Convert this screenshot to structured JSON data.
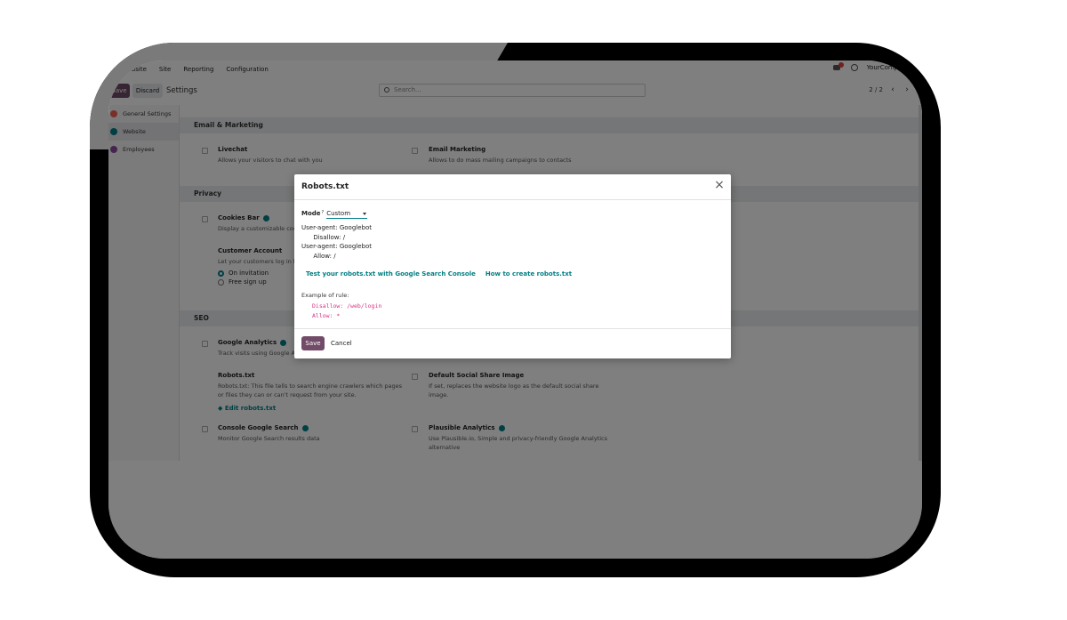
{
  "navbar": {
    "menu": [
      "Website",
      "Site",
      "Reporting",
      "Configuration"
    ],
    "company": "YourCompany"
  },
  "control_panel": {
    "save_label": "Save",
    "discard_label": "Discard",
    "title": "Settings",
    "search_placeholder": "Search...",
    "pager": "2 / 2",
    "prev": "‹",
    "next": "›"
  },
  "sidebar": {
    "items": [
      {
        "label": "General Settings",
        "color": "#f06050"
      },
      {
        "label": "Website",
        "color": "#017e84"
      },
      {
        "label": "Employees",
        "color": "#8a4a9c"
      }
    ]
  },
  "sections": {
    "email": {
      "title": "Email & Marketing",
      "livechat_title": "Livechat",
      "livechat_desc": "Allows your visitors to chat with you",
      "email_title": "Email Marketing",
      "email_desc": "Allows to do mass mailing campaigns to contacts"
    },
    "privacy": {
      "title": "Privacy",
      "cookies_title": "Cookies Bar",
      "cookies_desc": "Display a customizable coo",
      "account_title": "Customer Account",
      "account_desc": "Let your customers log in b",
      "radio_on": "On invitation",
      "radio_free": "Free sign up"
    },
    "seo": {
      "title": "SEO",
      "analytics_title": "Google Analytics",
      "analytics_desc": "Track visits using Google A",
      "robots_title": "Robots.txt",
      "robots_desc_1": "Robots.txt: This file tells to search engine crawlers which pages",
      "robots_desc_2": "or files they can or can't request from your site.",
      "robots_edit": "Edit robots.txt",
      "share_title": "Default Social Share Image",
      "share_desc_1": "If set, replaces the website logo as the default social share",
      "share_desc_2": "image.",
      "console_title": "Console Google Search",
      "console_desc": "Monitor Google Search results data",
      "plausible_title": "Plausible Analytics",
      "plausible_desc_1": "Use Plausible.io, Simple and privacy-friendly Google Analytics",
      "plausible_desc_2": "alternative"
    }
  },
  "dialog": {
    "title": "Robots.txt",
    "close": "×",
    "mode_label": "Mode",
    "mode_sup": "?",
    "mode_value": "Custom",
    "lines": [
      "User-agent: Googlebot",
      "      Disallow: /",
      "User-agent: Googlebot",
      "      Allow: /"
    ],
    "link_test": "Test your robots.txt with Google Search Console",
    "link_how": "How to create robots.txt",
    "example_label": "Example of rule:",
    "example_lines": [
      "Disallow: /web/login",
      "Allow: *"
    ],
    "save_label": "Save",
    "cancel_label": "Cancel"
  }
}
